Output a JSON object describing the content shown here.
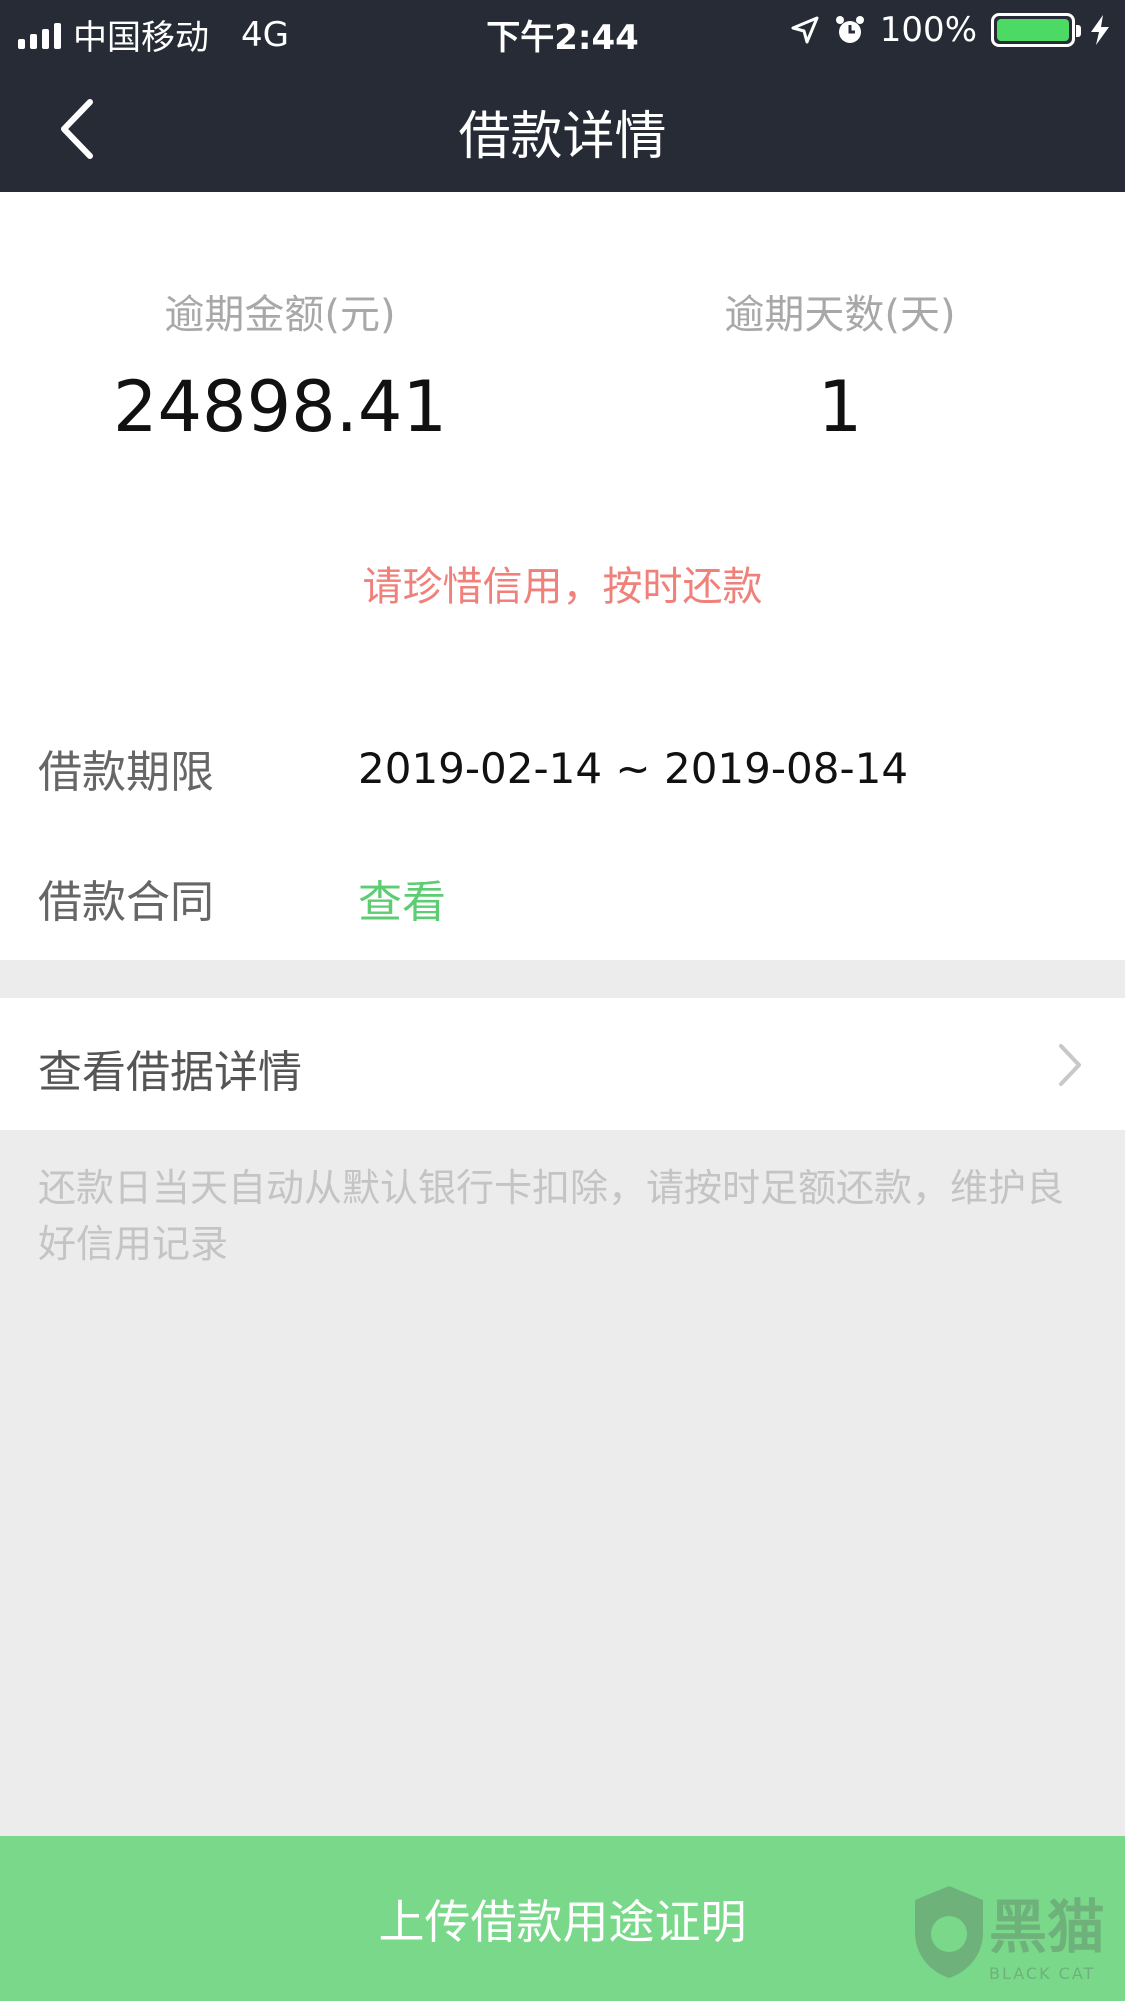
{
  "status_bar": {
    "carrier": "中国移动",
    "network": "4G",
    "time": "下午2:44",
    "battery": "100%"
  },
  "nav": {
    "title": "借款详情"
  },
  "summary": {
    "overdue_amount_label": "逾期金额(元)",
    "overdue_amount_value": "24898.41",
    "overdue_days_label": "逾期天数(天)",
    "overdue_days_value": "1",
    "tip": "请珍惜信用，按时还款"
  },
  "details": {
    "term_label": "借款期限",
    "term_value": "2019-02-14 ~ 2019-08-14",
    "contract_label": "借款合同",
    "contract_link": "查看"
  },
  "receipt": {
    "label": "查看借据详情"
  },
  "note": "还款日当天自动从默认银行卡扣除，请按时足额还款，维护良好信用记录",
  "upload_button": "上传借款用途证明",
  "watermark": {
    "text": "黑猫",
    "sub": "BLACK CAT"
  },
  "colors": {
    "header_bg": "#262b35",
    "tip": "#f0807a",
    "link": "#5dcc73",
    "button": "#7ad88a"
  }
}
